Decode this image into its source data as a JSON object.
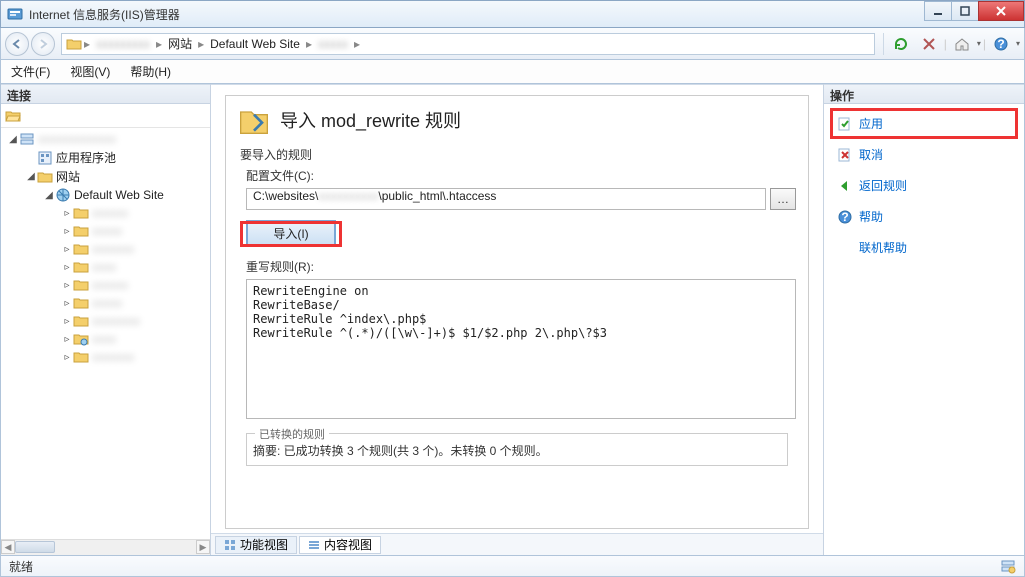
{
  "window": {
    "title": "Internet 信息服务(IIS)管理器"
  },
  "breadcrumb": {
    "items": [
      {
        "label": "",
        "blur": true
      },
      {
        "label": "网站"
      },
      {
        "label": "Default Web Site"
      },
      {
        "label": "",
        "blur": true
      }
    ]
  },
  "menubar": {
    "file": "文件(F)",
    "view": "视图(V)",
    "help": "帮助(H)"
  },
  "panels": {
    "connections": "连接",
    "actions": "操作"
  },
  "tree": {
    "root_blur": true,
    "app_pools": "应用程序池",
    "sites": "网站",
    "default_site": "Default Web Site",
    "child_count": 9
  },
  "page": {
    "title": "导入 mod_rewrite 规则",
    "rules_to_import": "要导入的规则",
    "config_file_label": "配置文件(C):",
    "config_file_value_prefix": "C:\\websites\\",
    "config_file_value_suffix": "\\public_html\\.htaccess",
    "import_button": "导入(I)",
    "rewrite_rules_label": "重写规则(R):",
    "rewrite_rules_text": "RewriteEngine on\nRewriteBase/\nRewriteRule ^index\\.php$\nRewriteRule ^(.*)/([\\w\\-]+)$ $1/$2.php 2\\.php\\?$3",
    "summary_legend": "已转换的规则",
    "summary_text": "摘要: 已成功转换 3 个规则(共 3 个)。未转换 0 个规则。"
  },
  "viewtabs": {
    "features": "功能视图",
    "content": "内容视图"
  },
  "actions": {
    "apply": "应用",
    "cancel": "取消",
    "back_rules": "返回规则",
    "help": "帮助",
    "online_help": "联机帮助"
  },
  "statusbar": {
    "ready": "就绪"
  }
}
